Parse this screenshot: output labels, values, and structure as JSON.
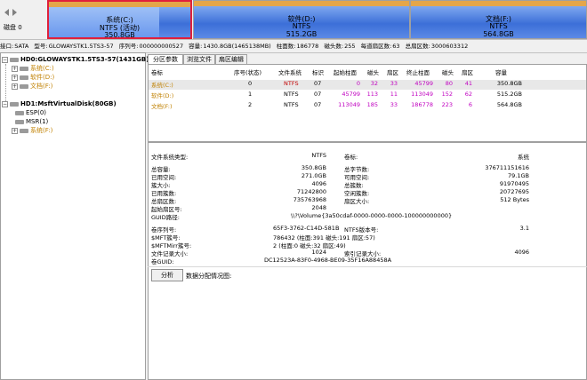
{
  "diskbar": {
    "disk_label": "磁盘 0",
    "partitions": [
      {
        "name": "系统(C:)",
        "fs": "NTFS (活动)",
        "size": "350.8GB"
      },
      {
        "name": "软件(D:)",
        "fs": "NTFS",
        "size": "515.2GB"
      },
      {
        "name": "文档(F:)",
        "fs": "NTFS",
        "size": "564.8GB"
      }
    ]
  },
  "infobar": {
    "interface_label": "接口:",
    "interface": "SATA",
    "model_label": "型号:",
    "model": "GLOWAYSTK1.5TS3-57",
    "serial_label": "序列号:",
    "serial": "000000000527",
    "capacity_label": "容量:",
    "capacity": "1430.8GB(1465138MB)",
    "cyl_label": "柱面数:",
    "cyl": "186778",
    "heads_label": "磁头数:",
    "heads": "255",
    "spt_label": "每道扇区数:",
    "spt": "63",
    "sectors_label": "总扇区数:",
    "sectors": "3000603312"
  },
  "tree": {
    "hd0": "HD0:GLOWAYSTK1.5TS3-57(1431GB)",
    "hd0_items": [
      "系统(C:)",
      "软件(D:)",
      "文档(F:)"
    ],
    "hd1": "HD1:MsftVirtualDisk(80GB)",
    "hd1_items": [
      "ESP(0)",
      "MSR(1)",
      "系统(F:)"
    ]
  },
  "tabs": [
    "分区参数",
    "浏览文件",
    "扇区编辑"
  ],
  "ptable": {
    "headers": [
      "卷标",
      "序号(状态)",
      "文件系统",
      "标识",
      "起始柱面",
      "磁头",
      "扇区",
      "终止柱面",
      "磁头",
      "扇区",
      "容量"
    ],
    "rows": [
      [
        "系统(C:)",
        "0",
        "NTFS",
        "07",
        "0",
        "32",
        "33",
        "45799",
        "80",
        "41",
        "350.8GB"
      ],
      [
        "软件(D:)",
        "1",
        "NTFS",
        "07",
        "45799",
        "113",
        "11",
        "113049",
        "152",
        "62",
        "515.2GB"
      ],
      [
        "文档(F:)",
        "2",
        "NTFS",
        "07",
        "113049",
        "185",
        "33",
        "186778",
        "223",
        "6",
        "564.8GB"
      ]
    ]
  },
  "details": {
    "fs_type_label": "文件系统类型:",
    "fs_type": "NTFS",
    "vol_label_label": "卷标:",
    "vol_label": "系统",
    "left": [
      {
        "k": "总容量:",
        "v": "350.8GB"
      },
      {
        "k": "已用空间:",
        "v": "271.0GB"
      },
      {
        "k": "簇大小:",
        "v": "4096"
      },
      {
        "k": "已用簇数:",
        "v": "71242800"
      },
      {
        "k": "总扇区数:",
        "v": "735763968"
      },
      {
        "k": "起始扇区号:",
        "v": "2048"
      }
    ],
    "right": [
      {
        "k": "总字节数:",
        "v": "376711151616"
      },
      {
        "k": "可用空间:",
        "v": "79.1GB"
      },
      {
        "k": "总簇数:",
        "v": "91970495"
      },
      {
        "k": "空闲簇数:",
        "v": "20727695"
      },
      {
        "k": "扇区大小:",
        "v": "512 Bytes"
      }
    ],
    "guid_path_label": "GUID路径:",
    "guid_path": "\\\\?\\Volume{3a50cdaf-0000-0000-0000-100000000000}",
    "serial_label": "卷序列号:",
    "serial": "65F3-3762-C14D-581B",
    "ntfs_ver_label": "NTFS版本号:",
    "ntfs_ver": "3.1",
    "mft_label": "$MFT簇号:",
    "mft": "786432 (柱面:391 磁头:191 扇区:57)",
    "mftmirr_label": "$MFTMirr簇号:",
    "mftmirr": "2 (柱面:0 磁头:32 扇区:49)",
    "frs_label": "文件记录大小:",
    "frs": "1024",
    "idx_label": "索引记录大小:",
    "idx": "4096",
    "vguid_label": "卷GUID:",
    "vguid": "DC12523A-83F0-4968-BE09-35F16A88458A",
    "analyze": "分析",
    "dist_label": "数据分配情况图:"
  }
}
